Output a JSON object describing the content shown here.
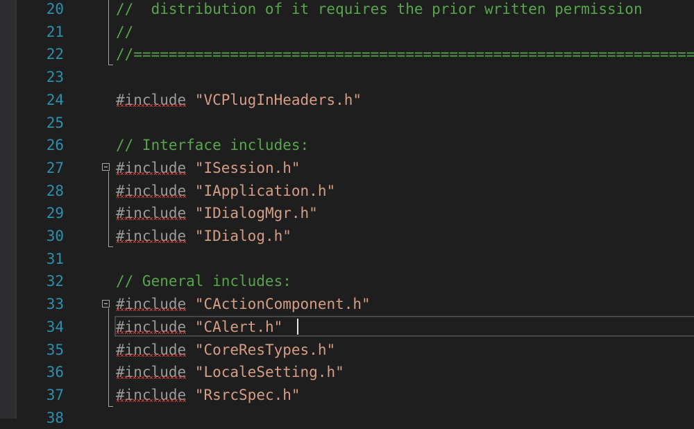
{
  "editor": {
    "lines": [
      {
        "number": "20",
        "segments": [
          {
            "type": "comment",
            "text": "//  distribution of it requires the prior written permission"
          }
        ]
      },
      {
        "number": "21",
        "segments": [
          {
            "type": "comment",
            "text": "//"
          }
        ]
      },
      {
        "number": "22",
        "segments": [
          {
            "type": "comment",
            "text": "//==================================================================="
          }
        ]
      },
      {
        "number": "23",
        "segments": []
      },
      {
        "number": "24",
        "segments": [
          {
            "type": "directive",
            "text": "#include"
          },
          {
            "type": "plain",
            "text": " "
          },
          {
            "type": "string",
            "text": "\"VCPlugInHeaders.h\""
          }
        ]
      },
      {
        "number": "25",
        "segments": []
      },
      {
        "number": "26",
        "segments": [
          {
            "type": "comment",
            "text": "// Interface includes:"
          }
        ]
      },
      {
        "number": "27",
        "segments": [
          {
            "type": "directive",
            "text": "#include"
          },
          {
            "type": "plain",
            "text": " "
          },
          {
            "type": "string",
            "text": "\"ISession.h\""
          }
        ]
      },
      {
        "number": "28",
        "segments": [
          {
            "type": "directive",
            "text": "#include"
          },
          {
            "type": "plain",
            "text": " "
          },
          {
            "type": "string",
            "text": "\"IApplication.h\""
          }
        ]
      },
      {
        "number": "29",
        "segments": [
          {
            "type": "directive",
            "text": "#include"
          },
          {
            "type": "plain",
            "text": " "
          },
          {
            "type": "string",
            "text": "\"IDialogMgr.h\""
          }
        ]
      },
      {
        "number": "30",
        "segments": [
          {
            "type": "directive",
            "text": "#include"
          },
          {
            "type": "plain",
            "text": " "
          },
          {
            "type": "string",
            "text": "\"IDialog.h\""
          }
        ]
      },
      {
        "number": "31",
        "segments": []
      },
      {
        "number": "32",
        "segments": [
          {
            "type": "comment",
            "text": "// General includes:"
          }
        ]
      },
      {
        "number": "33",
        "segments": [
          {
            "type": "directive",
            "text": "#include"
          },
          {
            "type": "plain",
            "text": " "
          },
          {
            "type": "string",
            "text": "\"CActionComponent.h\""
          }
        ]
      },
      {
        "number": "34",
        "segments": [
          {
            "type": "directive",
            "text": "#include"
          },
          {
            "type": "plain",
            "text": " "
          },
          {
            "type": "string",
            "text": "\"CAlert.h\""
          }
        ]
      },
      {
        "number": "35",
        "segments": [
          {
            "type": "directive",
            "text": "#include"
          },
          {
            "type": "plain",
            "text": " "
          },
          {
            "type": "string",
            "text": "\"CoreResTypes.h\""
          }
        ]
      },
      {
        "number": "36",
        "segments": [
          {
            "type": "directive",
            "text": "#include"
          },
          {
            "type": "plain",
            "text": " "
          },
          {
            "type": "string",
            "text": "\"LocaleSetting.h\""
          }
        ]
      },
      {
        "number": "37",
        "segments": [
          {
            "type": "directive",
            "text": "#include"
          },
          {
            "type": "plain",
            "text": " "
          },
          {
            "type": "string",
            "text": "\"RsrcSpec.h\""
          }
        ]
      },
      {
        "number": "38",
        "segments": []
      }
    ],
    "current_line": "34",
    "colors": {
      "background": "#1e1e1e",
      "line_number": "#2b91af",
      "comment": "#57a64a",
      "directive": "#9b9b9b",
      "string": "#d69d85",
      "squiggle": "#f14c4c"
    },
    "icons": [
      "collapse-outline-icon",
      "error-squiggle"
    ]
  }
}
